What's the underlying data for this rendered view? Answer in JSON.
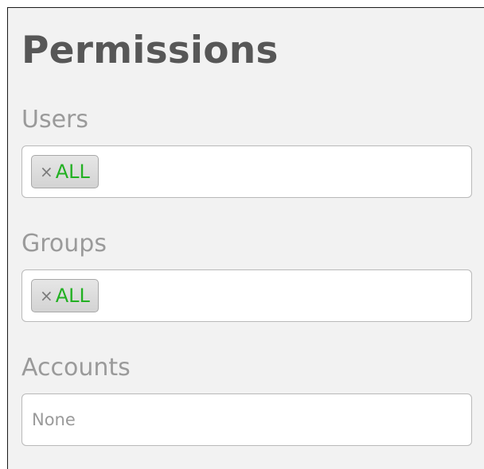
{
  "permissions": {
    "title": "Permissions",
    "users": {
      "label": "Users",
      "tags": [
        {
          "remove_glyph": "×",
          "text": "ALL"
        }
      ]
    },
    "groups": {
      "label": "Groups",
      "tags": [
        {
          "remove_glyph": "×",
          "text": "ALL"
        }
      ]
    },
    "accounts": {
      "label": "Accounts",
      "placeholder": "None"
    }
  }
}
